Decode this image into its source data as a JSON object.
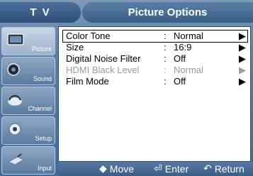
{
  "header": {
    "left_label": "T V",
    "title": "Picture Options"
  },
  "sidebar": {
    "items": [
      {
        "label": "Picture",
        "icon": "picture-icon",
        "active": true
      },
      {
        "label": "Sound",
        "icon": "sound-icon",
        "active": false
      },
      {
        "label": "Channel",
        "icon": "channel-icon",
        "active": false
      },
      {
        "label": "Setup",
        "icon": "setup-icon",
        "active": false
      },
      {
        "label": "Input",
        "icon": "input-icon",
        "active": false
      }
    ]
  },
  "menu": {
    "rows": [
      {
        "name": "Color Tone",
        "value": "Normal",
        "selected": true,
        "disabled": false
      },
      {
        "name": "Size",
        "value": "16:9",
        "selected": false,
        "disabled": false
      },
      {
        "name": "Digital Noise Filter",
        "value": "Off",
        "selected": false,
        "disabled": false
      },
      {
        "name": "HDMI Black Level",
        "value": "Normal",
        "selected": false,
        "disabled": true
      },
      {
        "name": "Film Mode",
        "value": "Off",
        "selected": false,
        "disabled": false
      }
    ],
    "colon": ":",
    "arrow": "▶"
  },
  "navbar": {
    "move_icon": "◆",
    "move_label": "Move",
    "enter_icon": "⏎",
    "enter_label": "Enter",
    "return_icon": "↶",
    "return_label": "Return"
  },
  "colors": {
    "panel_bg": "#ffffff",
    "disabled_text": "#9a9a9a",
    "bar_blue": "#3a5d88"
  }
}
